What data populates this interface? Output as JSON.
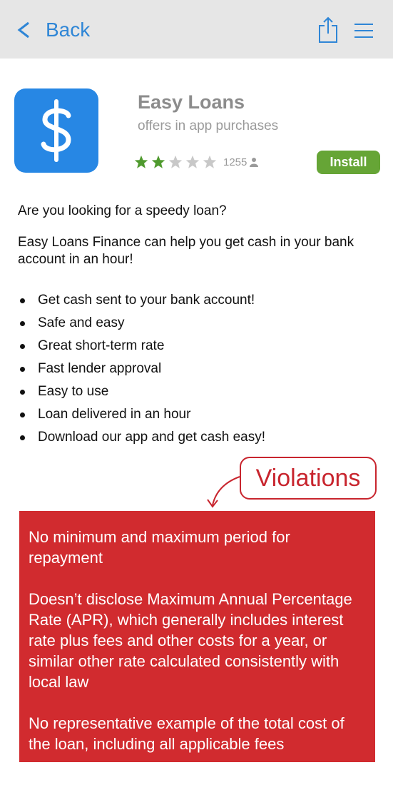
{
  "header": {
    "back_label": "Back"
  },
  "app": {
    "title": "Easy Loans",
    "subtitle": "offers in app purchases",
    "rating_filled": 2,
    "rating_total": 5,
    "rating_count": "1255",
    "install_label": "Install",
    "icon_color": "#2787e4"
  },
  "description": {
    "intro": "Are you looking for a speedy loan?",
    "paragraph": "Easy Loans Finance can help you get cash in your bank account in an hour!",
    "bullets": [
      "Get cash sent to your bank account!",
      "Safe and easy",
      "Great short-term rate",
      "Fast lender approval",
      "Easy to use",
      "Loan delivered in an hour",
      "Download our app and get cash easy!"
    ]
  },
  "annotation": {
    "callout": "Violations",
    "items": [
      "No minimum and maximum period for repayment",
      "Doesn’t disclose Maximum Annual Percentage Rate (APR), which generally includes interest rate plus fees and other costs for a year, or similar other rate calculated consistently with local law",
      "No representative example of the total cost of the loan, including all applicable fees"
    ],
    "color": "#d12b2f"
  }
}
